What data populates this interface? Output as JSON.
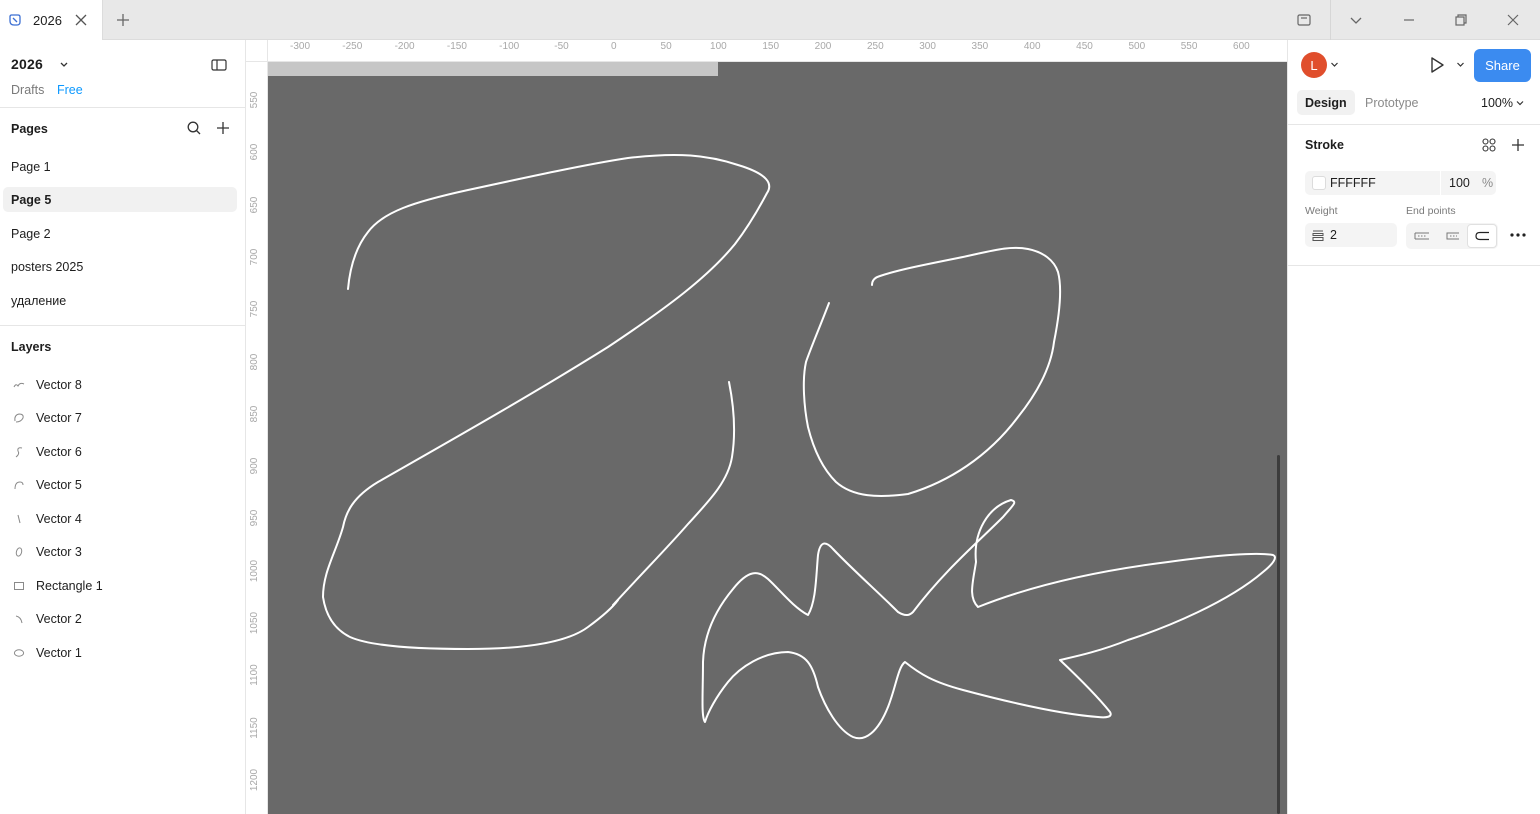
{
  "titlebar": {
    "tab_title": "2026",
    "tab_icon": "figma-draft-icon"
  },
  "file": {
    "name": "2026",
    "location": "Drafts",
    "plan": "Free"
  },
  "pages": {
    "title": "Pages",
    "items": [
      {
        "label": "Page 1",
        "selected": false
      },
      {
        "label": "Page 5",
        "selected": true
      },
      {
        "label": "Page 2",
        "selected": false
      },
      {
        "label": "posters 2025",
        "selected": false
      },
      {
        "label": "удаление",
        "selected": false
      }
    ]
  },
  "layers": {
    "title": "Layers",
    "items": [
      {
        "label": "Vector 8",
        "icon": "vector-scribble-icon"
      },
      {
        "label": "Vector 7",
        "icon": "vector-loop-icon"
      },
      {
        "label": "Vector 6",
        "icon": "vector-s-curve-icon"
      },
      {
        "label": "Vector 5",
        "icon": "vector-arc-icon"
      },
      {
        "label": "Vector 4",
        "icon": "vector-line-icon"
      },
      {
        "label": "Vector 3",
        "icon": "vector-oval-icon"
      },
      {
        "label": "Rectangle 1",
        "icon": "rectangle-icon"
      },
      {
        "label": "Vector 2",
        "icon": "vector-hook-icon"
      },
      {
        "label": "Vector 1",
        "icon": "vector-ellipse-icon"
      }
    ]
  },
  "rulers": {
    "horizontal": [
      "-300",
      "-250",
      "-200",
      "-150",
      "-100",
      "-50",
      "0",
      "50",
      "100",
      "150",
      "200",
      "250",
      "300",
      "350",
      "400",
      "450",
      "500",
      "550",
      "600"
    ],
    "vertical": [
      "550",
      "600",
      "650",
      "700",
      "750",
      "800",
      "850",
      "900",
      "950",
      "1000",
      "1050",
      "1100",
      "1150",
      "1200"
    ]
  },
  "canvas": {
    "background": "#696969",
    "stroke_color": "#FFFFFF"
  },
  "right_panel": {
    "avatar_initial": "L",
    "avatar_color": "#E04E2C",
    "share_label": "Share",
    "share_color": "#3B8BF0",
    "tabs": [
      {
        "label": "Design",
        "active": true
      },
      {
        "label": "Prototype",
        "active": false
      }
    ],
    "zoom": "100%",
    "stroke": {
      "title": "Stroke",
      "color_hex": "FFFFFF",
      "opacity": "100",
      "opacity_unit": "%",
      "weight_label": "Weight",
      "weight_value": "2",
      "endpoints_label": "End points",
      "endpoints_selected": 2
    }
  }
}
